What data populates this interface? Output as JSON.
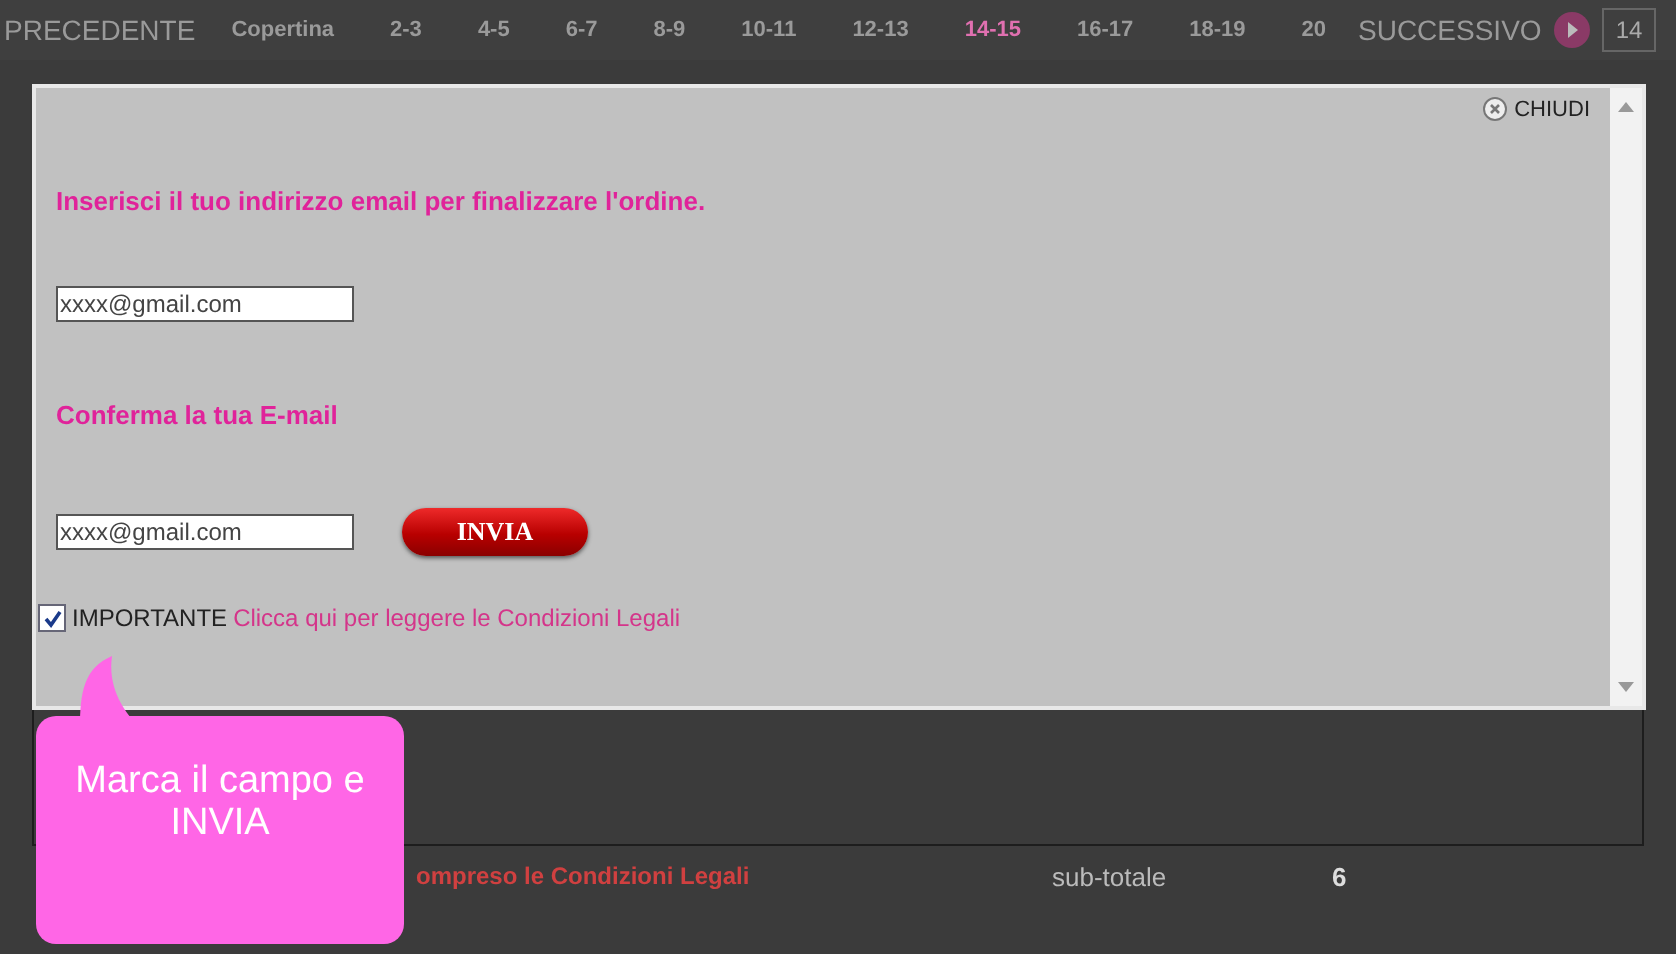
{
  "nav": {
    "previous": "PRECEDENTE",
    "pages": [
      {
        "label": "Copertina",
        "selected": false
      },
      {
        "label": "2-3",
        "selected": false
      },
      {
        "label": "4-5",
        "selected": false
      },
      {
        "label": "6-7",
        "selected": false
      },
      {
        "label": "8-9",
        "selected": false
      },
      {
        "label": "10-11",
        "selected": false
      },
      {
        "label": "12-13",
        "selected": false
      },
      {
        "label": "14-15",
        "selected": true
      },
      {
        "label": "16-17",
        "selected": false
      },
      {
        "label": "18-19",
        "selected": false
      },
      {
        "label": "20",
        "selected": false
      }
    ],
    "next": "SUCCESSIVO",
    "page_field": "14"
  },
  "cart": {
    "legal_text": "ompreso le Condizioni Legali",
    "subtotal_label": "sub-totale",
    "subtotal_value": "6"
  },
  "modal": {
    "close": "CHIUDI",
    "prompt": "Inserisci il tuo indirizzo email per finalizzare l'ordine.",
    "email": "xxxx@gmail.com",
    "confirm_label": "Conferma la tua E-mail",
    "confirm_email": "xxxx@gmail.com",
    "submit": "INVIA",
    "important": {
      "checked": true,
      "label": "IMPORTANTE",
      "link": "Clicca qui per leggere le Condizioni Legali"
    }
  },
  "callout": "Marca il campo e INVIA"
}
